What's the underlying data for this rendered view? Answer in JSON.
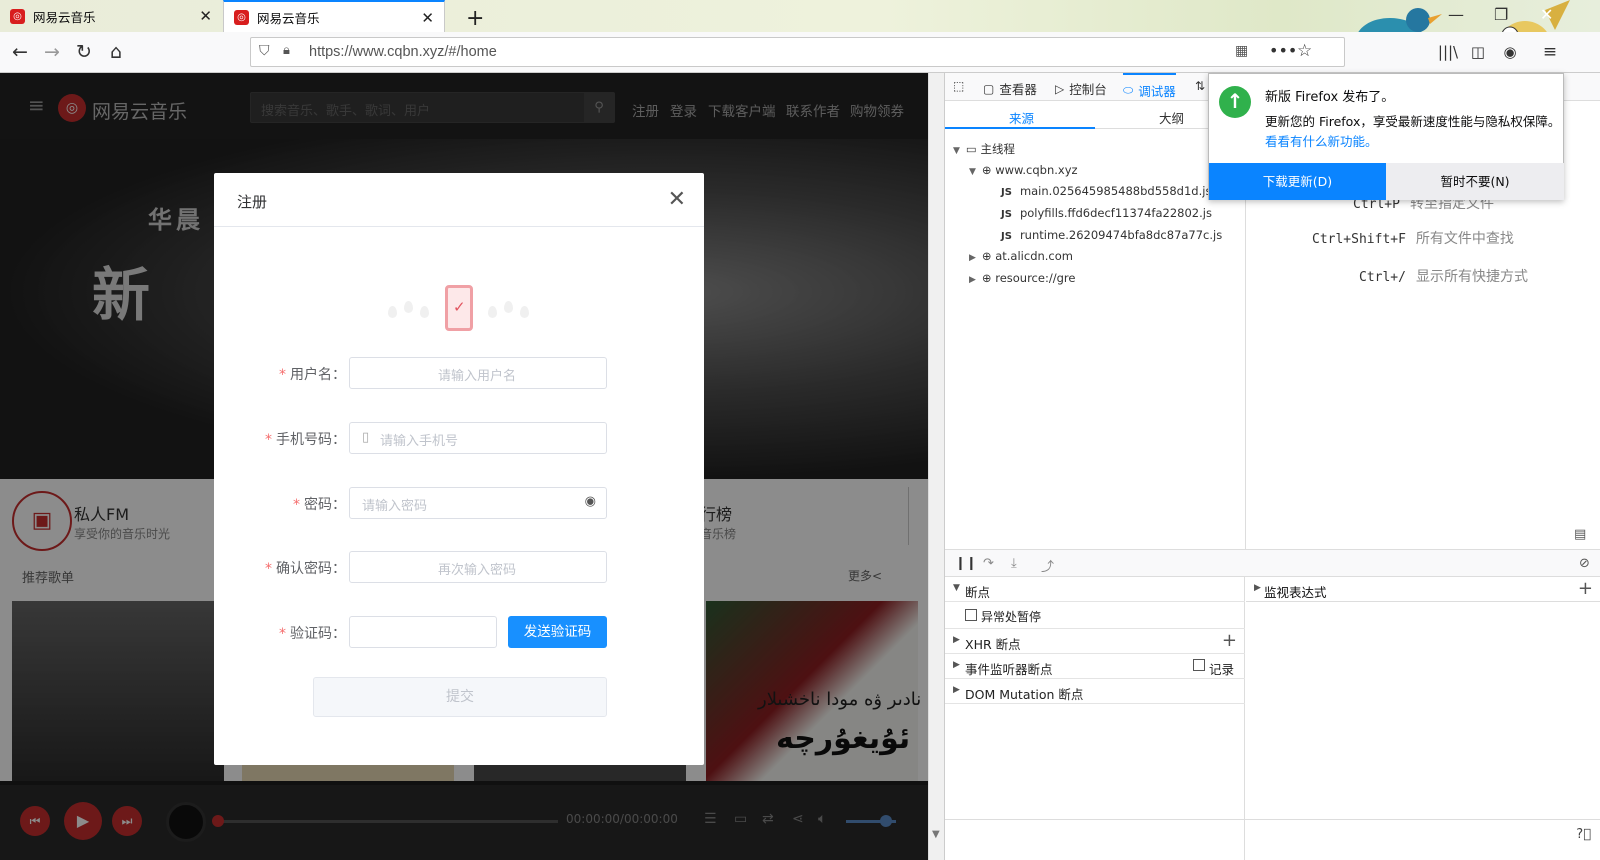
{
  "browser": {
    "tabs": [
      {
        "title": "网易云音乐"
      },
      {
        "title": "网易云音乐"
      }
    ],
    "url": "https://www.cqbn.xyz/#/home"
  },
  "site": {
    "logo": "网易云音乐",
    "search_placeholder": "搜索音乐、歌手、歌词、用户",
    "nav": [
      "注册",
      "登录",
      "下载客户端",
      "联系作者",
      "购物领券"
    ],
    "banner_line1": "华晨",
    "banner_line2": "新",
    "fm_title": "私人FM",
    "fm_sub": "享受你的音乐时光",
    "rank_title": "行榜",
    "rank_sub": "音乐榜",
    "recommend": "推荐歌单",
    "more": "更多<",
    "cover_text1": "نادىر ۋە مودا ناخشىلار",
    "cover_text2": "ئۇيغۇرچە",
    "time": "00:00:00/00:00:00"
  },
  "modal": {
    "title": "注册",
    "fields": {
      "username": {
        "label": "用户名",
        "placeholder": "请输入用户名"
      },
      "phone": {
        "label": "手机号码",
        "placeholder": "请输入手机号"
      },
      "password": {
        "label": "密码",
        "placeholder": "请输入密码"
      },
      "confirm": {
        "label": "确认密码",
        "placeholder": "再次输入密码"
      },
      "code": {
        "label": "验证码",
        "placeholder": ""
      }
    },
    "colon": "：",
    "send_code": "发送验证码",
    "submit": "提交"
  },
  "devtools": {
    "tabs": [
      "查看器",
      "控制台",
      "调试器"
    ],
    "source_tabs": [
      "来源",
      "大纲"
    ],
    "tree": {
      "main_thread": "主线程",
      "host": "www.cqbn.xyz",
      "files": [
        "main.025645985488bd558d1d.js",
        "polyfills.ffd6decf11374fa22802.js",
        "runtime.26209474bfa8dc87a77c.js"
      ],
      "others": [
        "at.alicdn.com",
        "resource://gre"
      ]
    },
    "shortcuts": [
      {
        "key": "Ctrl+P",
        "desc": "转至指定文件"
      },
      {
        "key": "Ctrl+Shift+F",
        "desc": "所有文件中查找"
      },
      {
        "key": "Ctrl+/",
        "desc": "显示所有快捷方式"
      }
    ],
    "breakpoints": "断点",
    "pause_exceptions": "异常处暂停",
    "xhr": "XHR 断点",
    "events": "事件监听器断点",
    "log": "记录",
    "dom": "DOM Mutation 断点",
    "watch": "监视表达式"
  },
  "notification": {
    "title": "新版 Firefox 发布了。",
    "body": "更新您的 Firefox，享受最新速度性能与隐私权保障。",
    "link": "看看有什么新功能。",
    "primary": "下载更新(D)",
    "secondary": "暂时不要(N)"
  },
  "colors": {
    "accent": "#0a84ff",
    "brand": "#c62f2f",
    "send": "#1890ff"
  }
}
